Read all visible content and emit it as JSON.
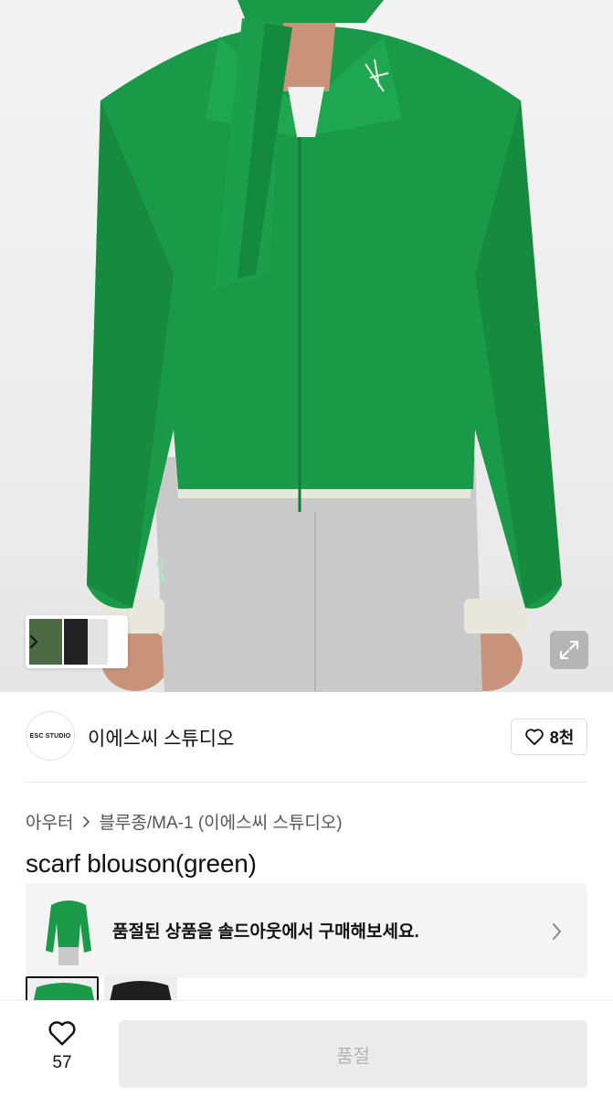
{
  "brand": {
    "logo_text": "ESC STUDIO",
    "name": "이에스씨 스튜디오",
    "like_count": "8천"
  },
  "breadcrumb": {
    "category": "아우터",
    "subcategory": "블루종/MA-1 (이에스씨 스튜디오)"
  },
  "product": {
    "title": "scarf blouson(green)",
    "main_color": "#1a9a48"
  },
  "soldout_banner": {
    "text": "품절된 상품을 솔드아웃에서 구매해보세요."
  },
  "bottom_bar": {
    "wish_count": "57",
    "buy_label": "품절"
  },
  "icons": {
    "expand": "expand-icon",
    "heart": "heart-icon",
    "chevron": "chevron-right-icon"
  }
}
